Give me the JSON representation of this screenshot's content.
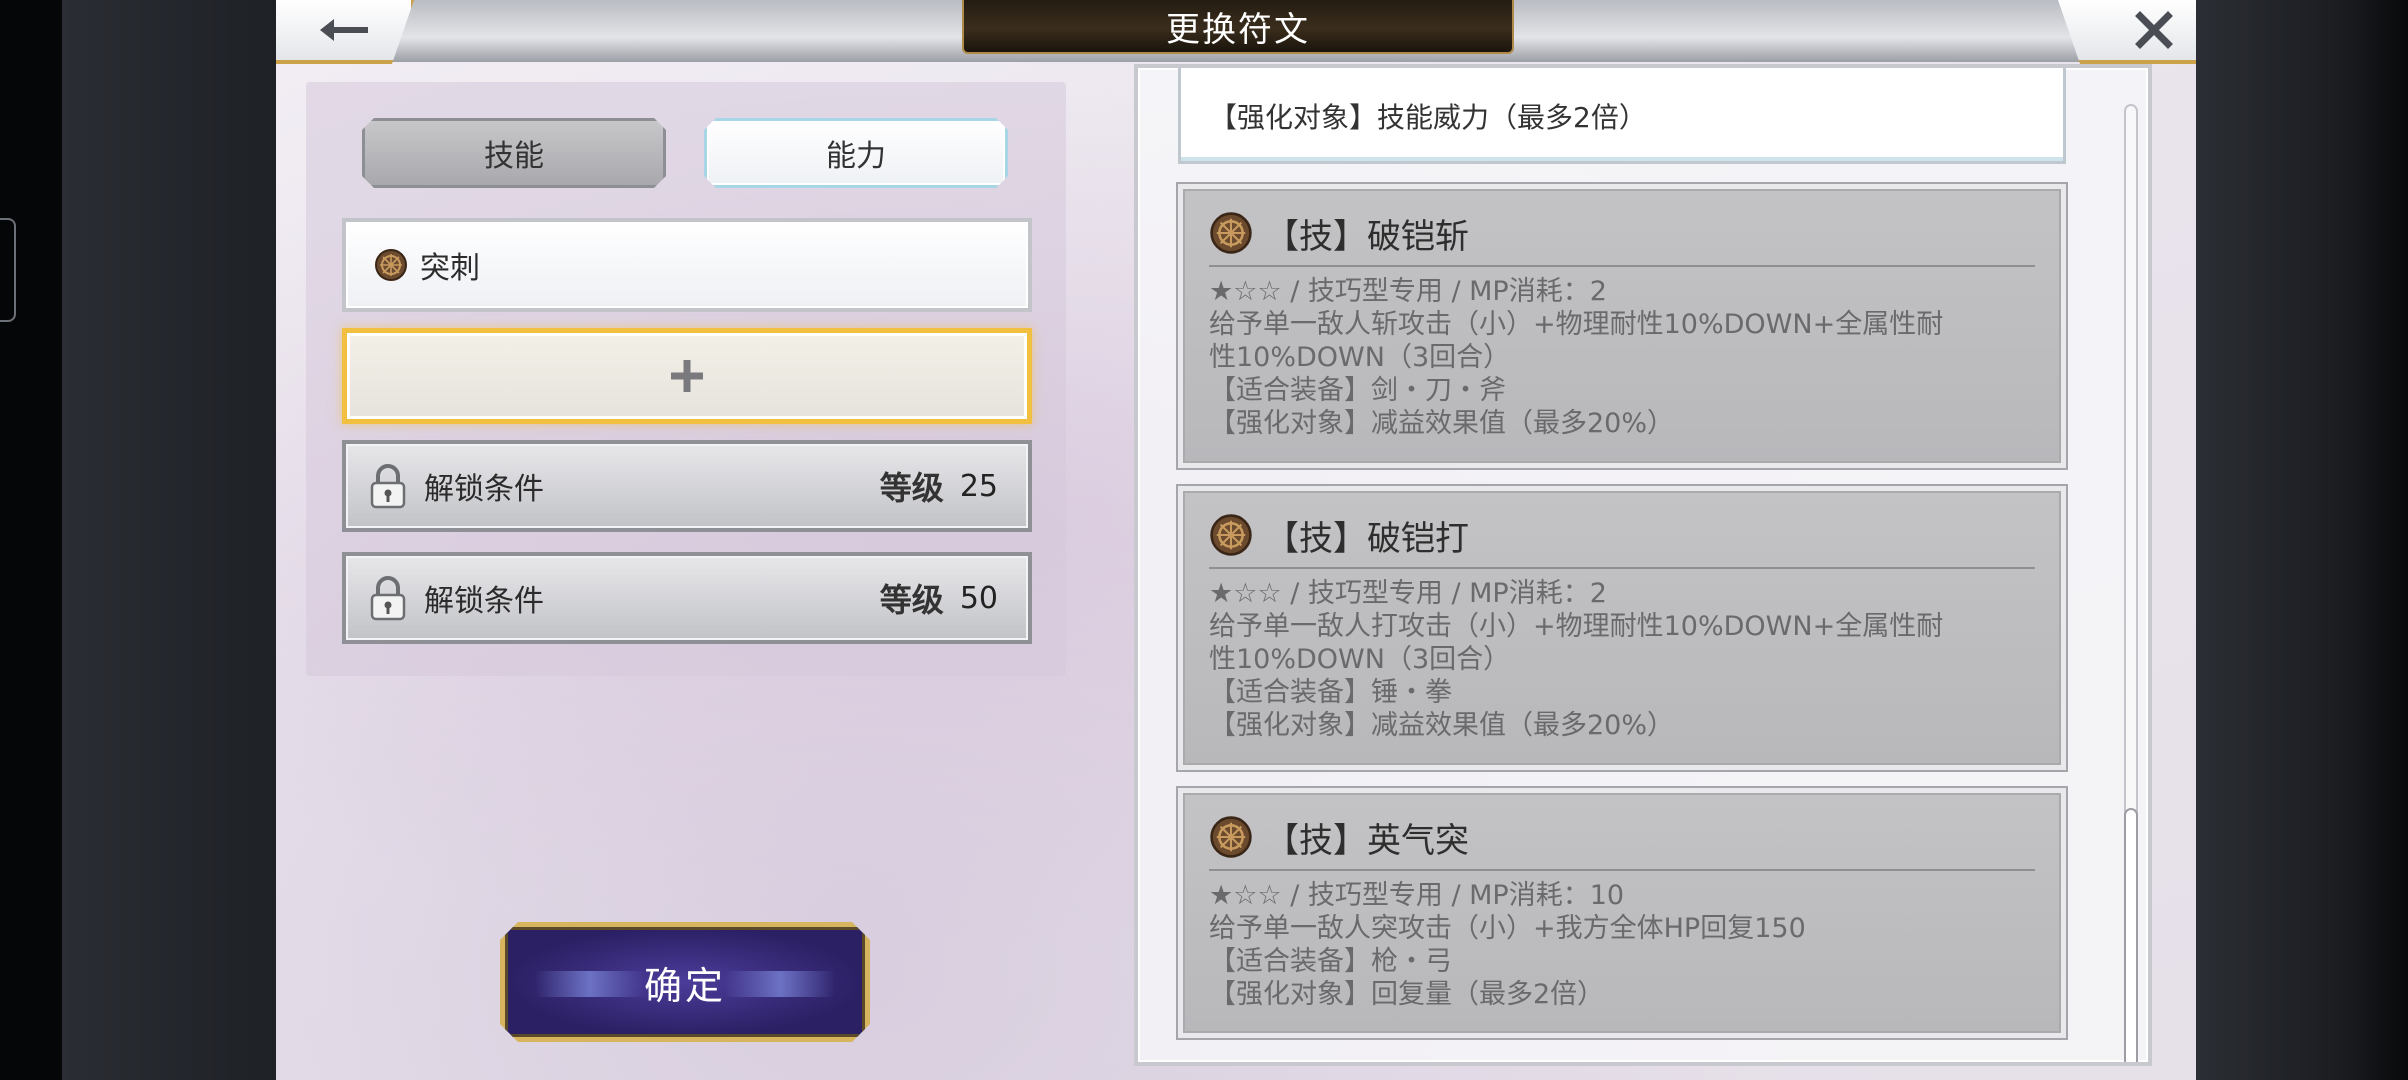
{
  "header": {
    "title": "更换符文"
  },
  "tabs": {
    "skill": "技能",
    "ability": "能力"
  },
  "slots": {
    "equipped_rune": "突刺",
    "add_symbol": "+",
    "locked": [
      {
        "label": "解锁条件",
        "level_label": "等级",
        "level": "25"
      },
      {
        "label": "解锁条件",
        "level_label": "等级",
        "level": "50"
      }
    ]
  },
  "confirm_label": "确定",
  "rune_list": {
    "partial_line": "【强化对象】技能威力（最多2倍）",
    "cards": [
      {
        "title": "【技】破铠斩",
        "lines": [
          "★☆☆ / 技巧型专用 / MP消耗：2",
          "给予单一敌人斩攻击（小）+物理耐性10%DOWN+全属性耐",
          "性10%DOWN（3回合）",
          "【适合装备】剑・刀・斧",
          "【强化对象】减益效果值（最多20%）"
        ]
      },
      {
        "title": "【技】破铠打",
        "lines": [
          "★☆☆ / 技巧型专用 / MP消耗：2",
          "给予单一敌人打攻击（小）+物理耐性10%DOWN+全属性耐",
          "性10%DOWN（3回合）",
          "【适合装备】锤・拳",
          "【强化对象】减益效果值（最多20%）"
        ]
      },
      {
        "title": "【技】英气突",
        "lines": [
          "★☆☆ / 技巧型专用 / MP消耗：10",
          "给予单一敌人突攻击（小）+我方全体HP回复150",
          "【适合装备】枪・弓",
          "【强化对象】回复量（最多2倍）"
        ]
      }
    ]
  },
  "colors": {
    "highlight": "#f2c040",
    "confirm": "#2b2064",
    "title_plate": "#241c12"
  },
  "icons": [
    "back-arrow-icon",
    "close-icon",
    "rune-icon",
    "plus-icon",
    "lock-icon"
  ]
}
